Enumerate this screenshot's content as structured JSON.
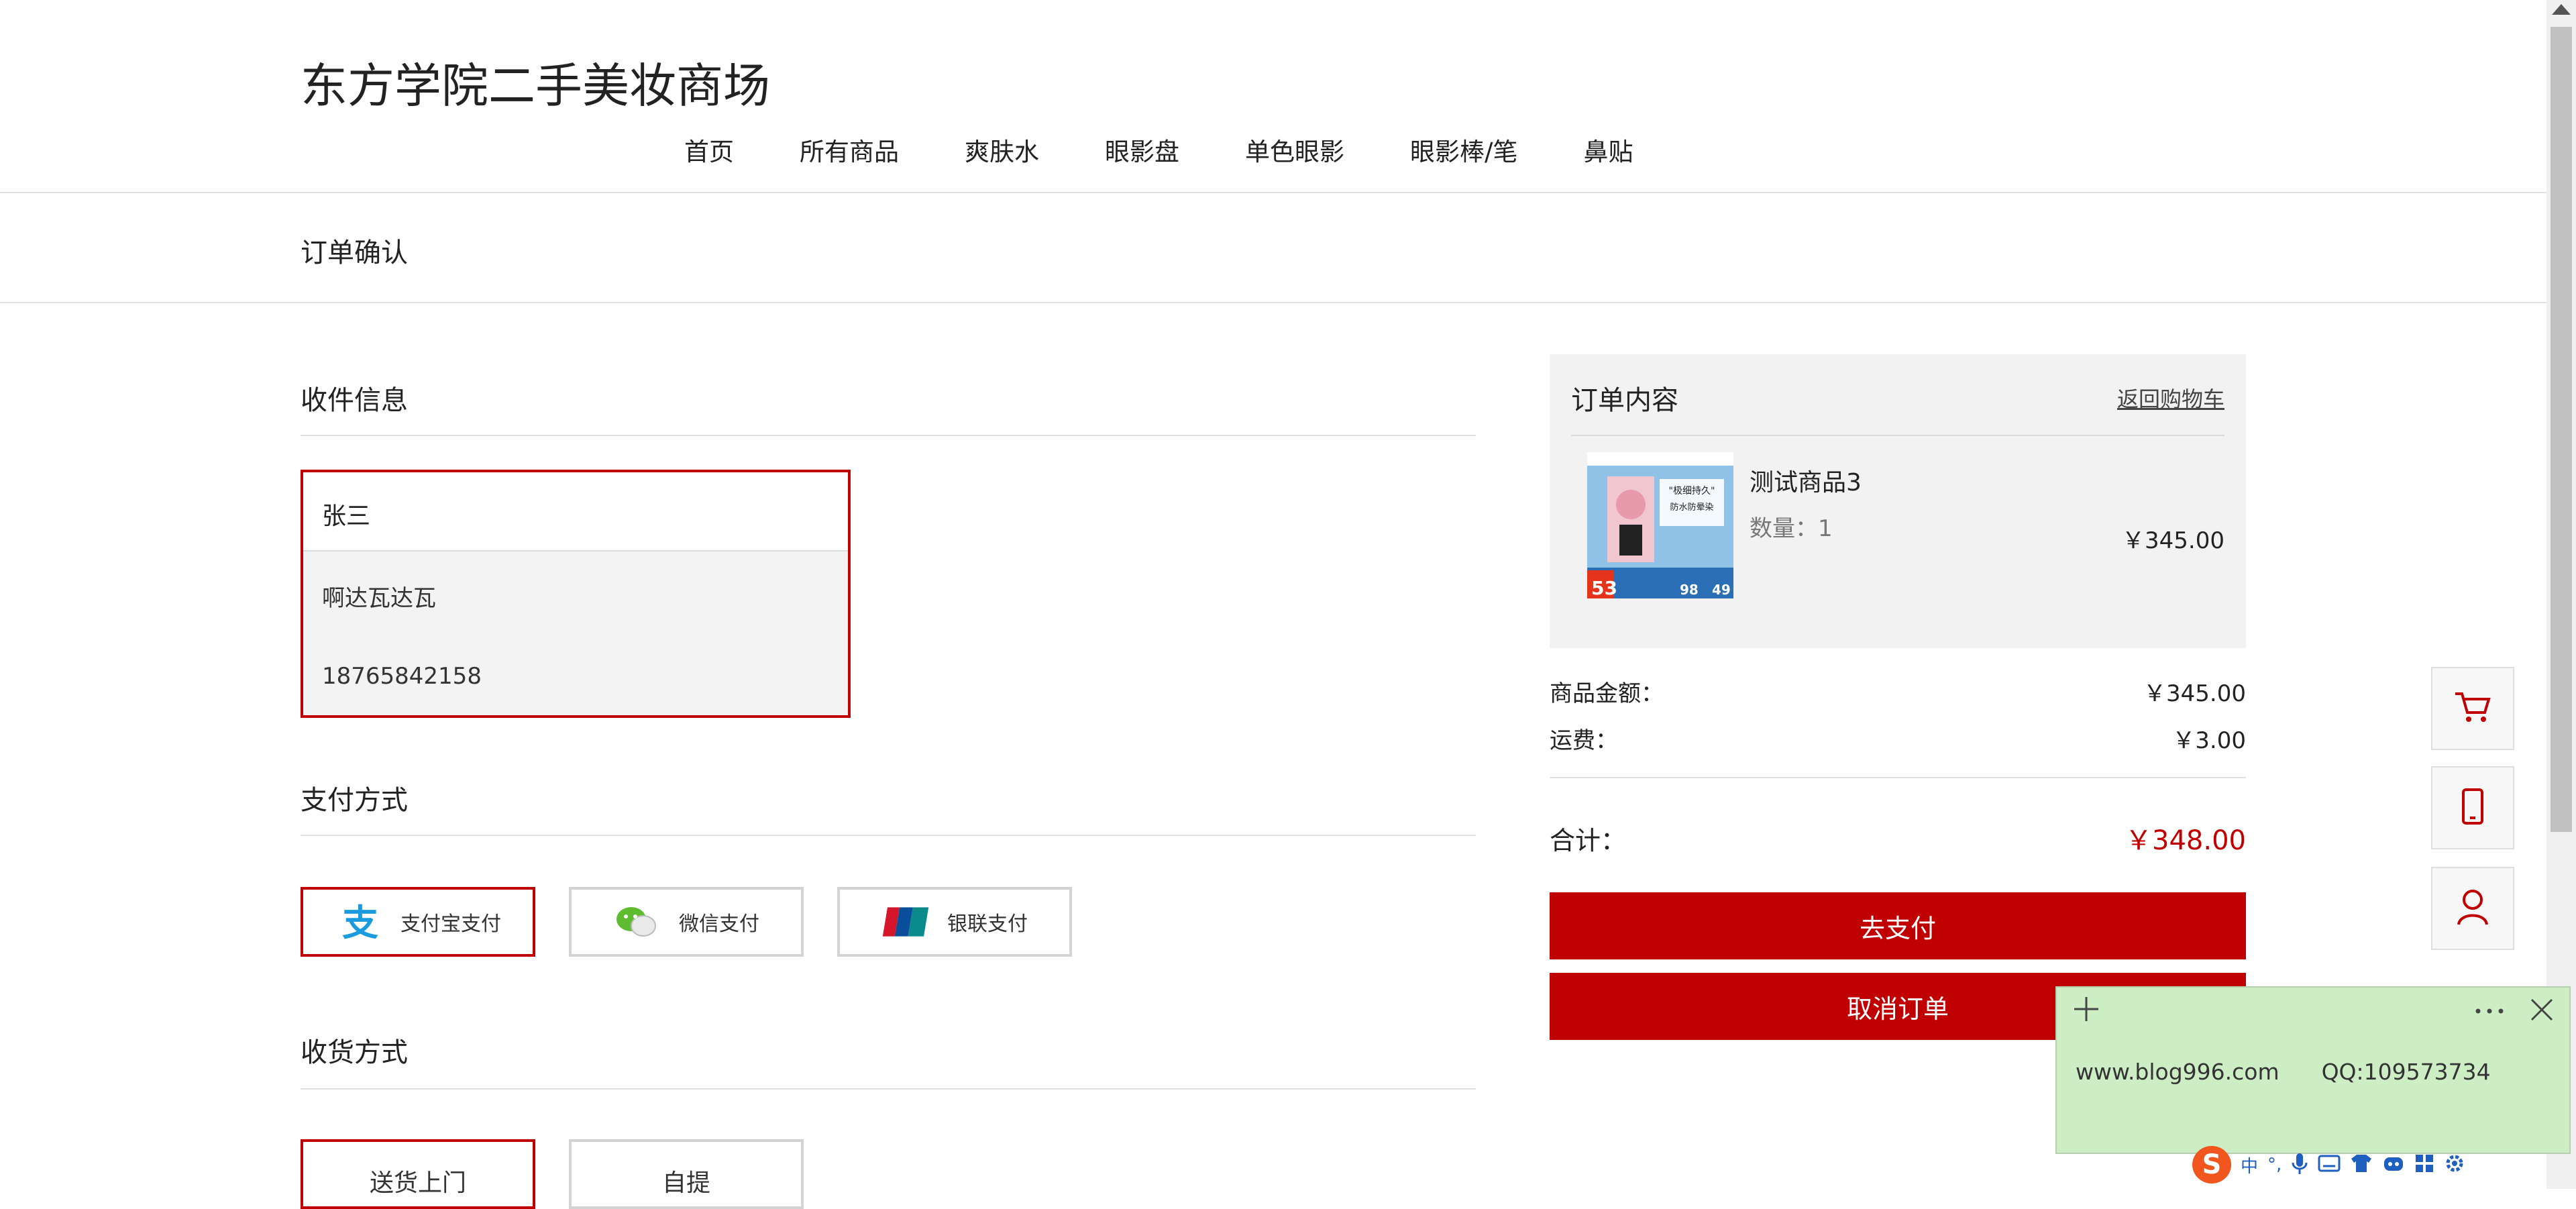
{
  "site": {
    "title": "东方学院二手美妆商场"
  },
  "nav": {
    "items": [
      "首页",
      "所有商品",
      "爽肤水",
      "眼影盘",
      "单色眼影",
      "眼影棒/笔",
      "鼻贴"
    ]
  },
  "page": {
    "heading": "订单确认"
  },
  "shipping_info": {
    "title": "收件信息",
    "name": "张三",
    "address": "啊达瓦达瓦",
    "phone": "18765842158"
  },
  "payment": {
    "title": "支付方式",
    "options": [
      {
        "label": "支付宝支付",
        "selected": true
      },
      {
        "label": "微信支付",
        "selected": false
      },
      {
        "label": "银联支付",
        "selected": false
      }
    ]
  },
  "delivery": {
    "title": "收货方式",
    "options": [
      {
        "label": "送货上门",
        "selected": true
      },
      {
        "label": "自提",
        "selected": false
      }
    ]
  },
  "order": {
    "title": "订单内容",
    "back_link": "返回购物车",
    "item": {
      "name": "测试商品3",
      "quantity": "数量：1",
      "price": "￥345.00"
    },
    "thumb_text": {
      "tag": "\"极细持久\"",
      "sub": "防水防晕染",
      "num1": "53",
      "num2": "98",
      "num3": "49"
    },
    "subtotal_label": "商品金额：",
    "subtotal_value": "￥345.00",
    "shipping_label": "运费：",
    "shipping_value": "￥3.00",
    "total_label": "合计：",
    "total_value": "￥348.00",
    "pay_button": "去支付",
    "cancel_button": "取消订单"
  },
  "sticky_note": {
    "text": "www.blog996.com      QQ:109573734"
  },
  "ime": {
    "logo": "S",
    "mode": "中",
    "punct": "°,"
  },
  "colors": {
    "accent": "#c00000",
    "note_bg": "#cdeec4",
    "panel_bg": "#f2f2f2"
  },
  "icons": [
    "cart-icon",
    "phone-icon",
    "user-icon",
    "alipay-icon",
    "wechat-icon",
    "unionpay-icon"
  ]
}
